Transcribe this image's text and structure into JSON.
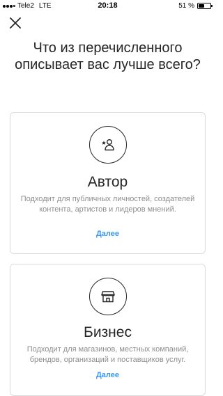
{
  "status_bar": {
    "carrier": "Tele2",
    "network": "LTE",
    "time": "20:18",
    "battery_percent": "51 %",
    "battery_level": 0.51,
    "signal_bars": 3
  },
  "header": {
    "close_icon": "close-icon"
  },
  "question": "Что из перечисленного описывает вас лучше всего?",
  "cards": [
    {
      "icon": "person-star-icon",
      "title": "Автор",
      "description": "Подходит для публичных личностей, создателей контента, артистов и лидеров мнений.",
      "link": "Далее"
    },
    {
      "icon": "storefront-icon",
      "title": "Бизнес",
      "description": "Подходит для магазинов, местных компаний, брендов, организаций и поставщиков услуг.",
      "link": "Далее"
    }
  ],
  "colors": {
    "accent": "#3897f0",
    "text": "#262626",
    "muted": "#8e8e8e",
    "border": "#dbdbdb"
  }
}
